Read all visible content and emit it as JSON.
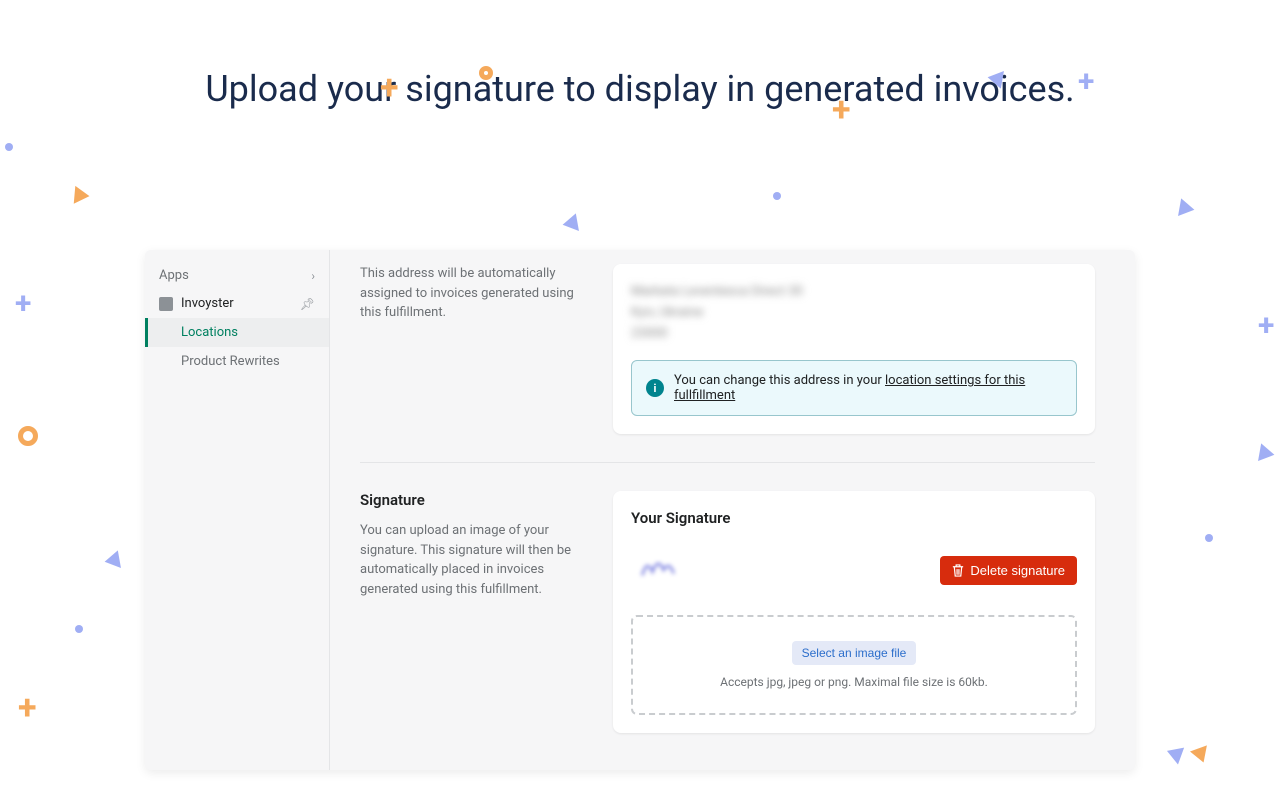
{
  "page_title": "Upload your signature to display in generated invoices.",
  "sidebar": {
    "header": "Apps",
    "app_name": "Invoyster",
    "items": [
      {
        "label": "Locations",
        "active": true
      },
      {
        "label": "Product Rewrites",
        "active": false
      }
    ]
  },
  "address_section": {
    "description": "This address will be automatically assigned to invoices generated using this fulfillment.",
    "blur_lines": [
      "Markata Leventesca Direct 30",
      "Kyiv, Ukraine",
      "23000"
    ],
    "info_text": "You can change this address in your ",
    "info_link": "location settings for this fullfillment"
  },
  "signature_section": {
    "title": "Signature",
    "description": "You can upload an image of your signature. This signature will then be automatically placed in invoices generated using this fulfillment.",
    "card_title": "Your Signature",
    "delete_label": "Delete signature",
    "select_label": "Select an image file",
    "hint": "Accepts jpg, jpeg or png. Maximal file size is 60kb."
  }
}
